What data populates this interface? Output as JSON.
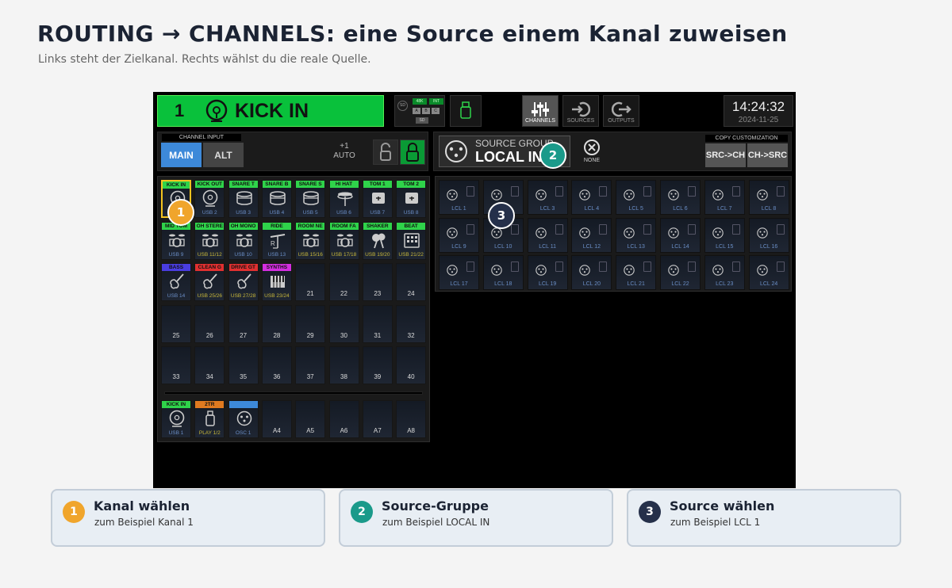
{
  "page": {
    "title": "ROUTING → CHANNELS: eine Source einem Kanal zuweisen",
    "subtitle": "Links steht der Zielkanal. Rechts wählst du die reale Quelle."
  },
  "topbar": {
    "channel_number": "1",
    "channel_name": "KICK IN",
    "channel_color": "#09c13b",
    "status": {
      "rate": "48K",
      "clock": "INT",
      "slots": [
        "A",
        "B",
        "C"
      ],
      "sd": "SD"
    },
    "nav": [
      {
        "label": "CHANNELS",
        "icon": "faders-icon",
        "active": true
      },
      {
        "label": "SOURCES",
        "icon": "input-arrow-icon",
        "active": false
      },
      {
        "label": "OUTPUTS",
        "icon": "output-arrow-icon",
        "active": false
      }
    ],
    "time": "14:24:32",
    "date": "2024-11-25"
  },
  "channel_input": {
    "title": "CHANNEL INPUT",
    "main": "MAIN",
    "alt": "ALT",
    "trim_value": "+1",
    "trim_label": "AUTO"
  },
  "source_group": {
    "label": "SOURCE GROUP",
    "value": "LOCAL IN",
    "none_label": "NONE"
  },
  "copy": {
    "title": "COPY CUSTOMIZATION",
    "src_to_ch": "SRC->CH",
    "ch_to_src": "CH->SRC"
  },
  "channels": [
    {
      "name": "KICK IN",
      "color": "#2fd34a",
      "src": "",
      "icon": "kick-drum"
    },
    {
      "name": "KICK OUT",
      "color": "#2fd34a",
      "src": "USB 2",
      "icon": "kick-drum"
    },
    {
      "name": "SNARE T",
      "color": "#2fd34a",
      "src": "USB 3",
      "icon": "snare-drum"
    },
    {
      "name": "SNARE B",
      "color": "#2fd34a",
      "src": "USB 4",
      "icon": "snare-drum"
    },
    {
      "name": "SNARE S",
      "color": "#2fd34a",
      "src": "USB 5",
      "icon": "snare-drum"
    },
    {
      "name": "HI HAT",
      "color": "#2fd34a",
      "src": "USB 6",
      "icon": "hihat"
    },
    {
      "name": "TOM 1",
      "color": "#2fd34a",
      "src": "USB 7",
      "icon": "tom"
    },
    {
      "name": "TOM 2",
      "color": "#2fd34a",
      "src": "USB 8",
      "icon": "tom"
    },
    {
      "name": "MID TOM",
      "color": "#2fd34a",
      "src": "USB 9",
      "icon": "drumkit"
    },
    {
      "name": "OH STERE",
      "color": "#2fd34a",
      "src": "USB 11/12",
      "icon": "drumkit"
    },
    {
      "name": "OH MONO",
      "color": "#2fd34a",
      "src": "USB 10",
      "icon": "drumkit"
    },
    {
      "name": "RIDE",
      "color": "#2fd34a",
      "src": "USB 13",
      "icon": "cymbal"
    },
    {
      "name": "ROOM NE",
      "color": "#2fd34a",
      "src": "USB 15/16",
      "icon": "drumkit"
    },
    {
      "name": "ROOM FA",
      "color": "#2fd34a",
      "src": "USB 17/18",
      "icon": "drumkit"
    },
    {
      "name": "SHAKER",
      "color": "#2fd34a",
      "src": "USB 19/20",
      "icon": "maracas"
    },
    {
      "name": "BEAT",
      "color": "#2fd34a",
      "src": "USB 21/22",
      "icon": "drum-machine"
    },
    {
      "name": "BASS",
      "color": "#4a3de0",
      "src": "USB 14",
      "icon": "guitar"
    },
    {
      "name": "CLEAN G",
      "color": "#e03030",
      "src": "USB 25/26",
      "icon": "guitar"
    },
    {
      "name": "DRIVE GT",
      "color": "#e03030",
      "src": "USB 27/28",
      "icon": "guitar"
    },
    {
      "name": "SYNTHS",
      "color": "#d42ee0",
      "src": "USB 23/24",
      "icon": "keyboard"
    },
    {
      "num": "21"
    },
    {
      "num": "22"
    },
    {
      "num": "23"
    },
    {
      "num": "24"
    },
    {
      "num": "25"
    },
    {
      "num": "26"
    },
    {
      "num": "27"
    },
    {
      "num": "28"
    },
    {
      "num": "29"
    },
    {
      "num": "30"
    },
    {
      "num": "31"
    },
    {
      "num": "32"
    },
    {
      "num": "33"
    },
    {
      "num": "34"
    },
    {
      "num": "35"
    },
    {
      "num": "36"
    },
    {
      "num": "37"
    },
    {
      "num": "38"
    },
    {
      "num": "39"
    },
    {
      "num": "40"
    }
  ],
  "aux": [
    {
      "name": "KICK IN",
      "color": "#2fd34a",
      "src": "USB 1",
      "icon": "kick-drum"
    },
    {
      "name": "2TR",
      "color": "#e07a20",
      "src": "PLAY 1/2",
      "icon": "usb-stick"
    },
    {
      "name": "",
      "color": "#3d89d9",
      "src": "OSC 1",
      "icon": "xlr"
    },
    {
      "num": "A4"
    },
    {
      "num": "A5"
    },
    {
      "num": "A6"
    },
    {
      "num": "A7"
    },
    {
      "num": "A8"
    }
  ],
  "sources": [
    "LCL 1",
    "LCL 2",
    "LCL 3",
    "LCL 4",
    "LCL 5",
    "LCL 6",
    "LCL 7",
    "LCL 8",
    "LCL 9",
    "LCL 10",
    "LCL 11",
    "LCL 12",
    "LCL 13",
    "LCL 14",
    "LCL 15",
    "LCL 16",
    "LCL 17",
    "LCL 18",
    "LCL 19",
    "LCL 20",
    "LCL 21",
    "LCL 22",
    "LCL 23",
    "LCL 24"
  ],
  "markers": [
    "1",
    "2",
    "3"
  ],
  "cards": [
    {
      "n": "1",
      "title": "Kanal wählen",
      "text": "zum Beispiel Kanal 1",
      "color": "#f0a52c"
    },
    {
      "n": "2",
      "title": "Source-Gruppe",
      "text": "zum Beispiel LOCAL IN",
      "color": "#1a9a8a"
    },
    {
      "n": "3",
      "title": "Source wählen",
      "text": "zum Beispiel LCL 1",
      "color": "#25304a"
    }
  ]
}
